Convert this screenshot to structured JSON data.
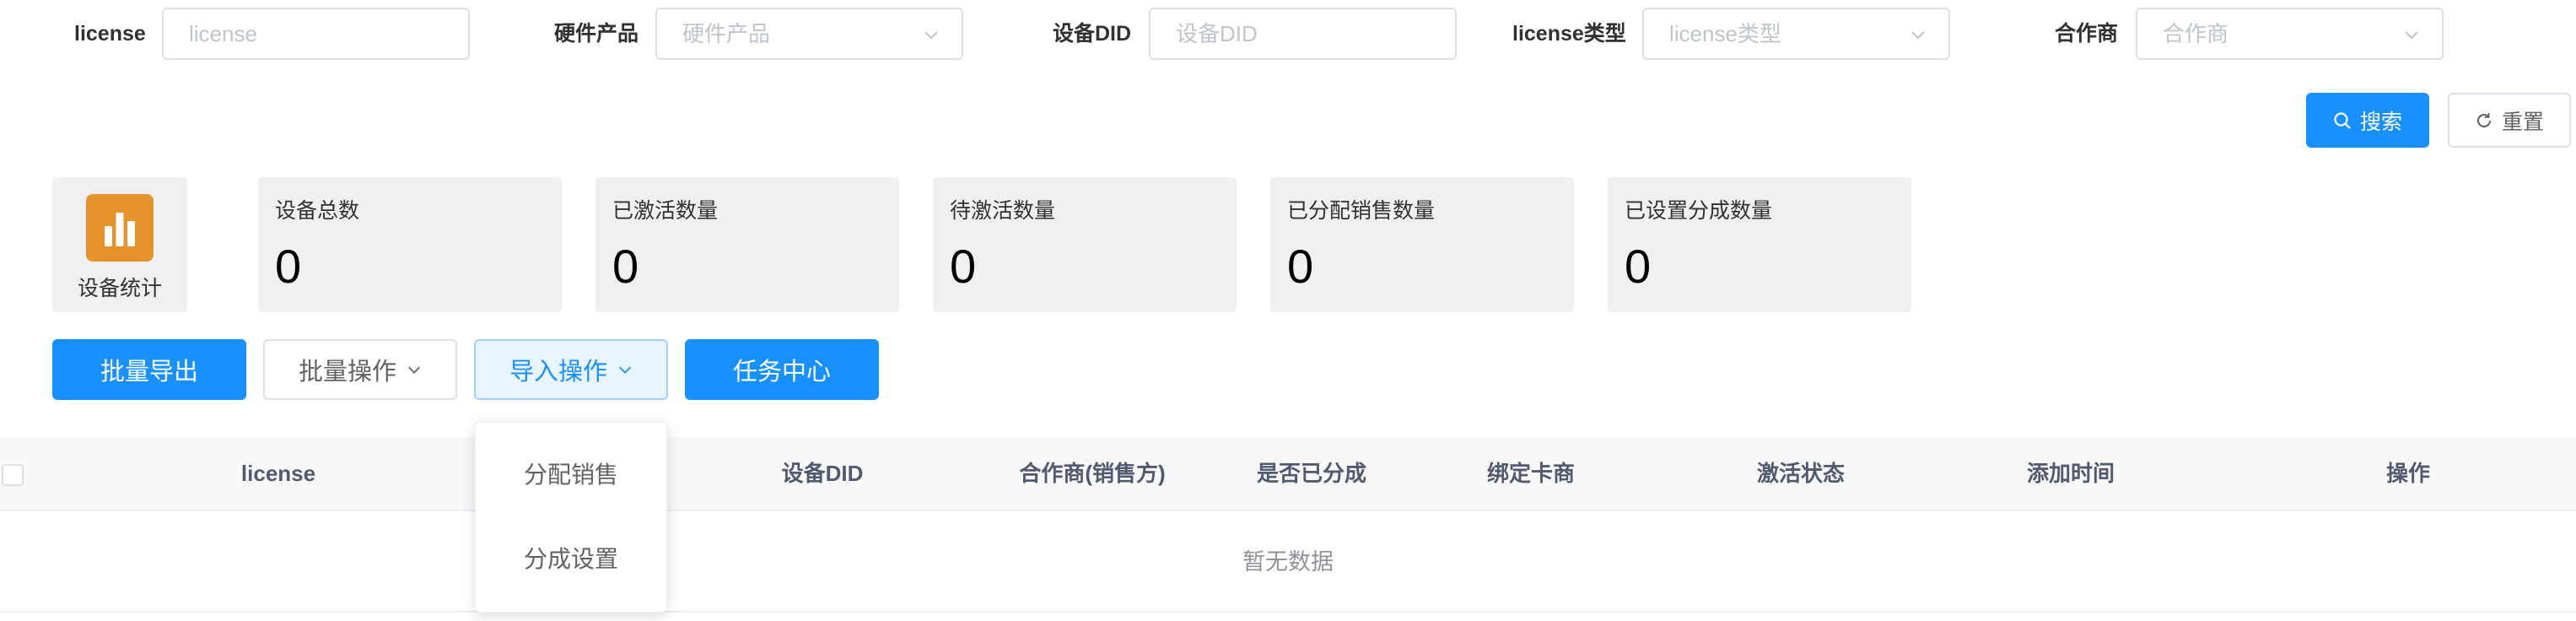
{
  "filters": {
    "license": {
      "label": "license",
      "placeholder": "license"
    },
    "hardware_product": {
      "label": "硬件产品",
      "placeholder": "硬件产品"
    },
    "device_did": {
      "label": "设备DID",
      "placeholder": "设备DID"
    },
    "license_type": {
      "label": "license类型",
      "placeholder": "license类型"
    },
    "partner": {
      "label": "合作商",
      "placeholder": "合作商"
    }
  },
  "buttons": {
    "search": "搜索",
    "reset": "重置",
    "batch_export": "批量导出",
    "batch_operation": "批量操作",
    "import_operation": "导入操作",
    "task_center": "任务中心"
  },
  "stats": {
    "icon_label": "设备统计",
    "icon_name": "bar-chart-icon",
    "cards": [
      {
        "title": "设备总数",
        "value": "0"
      },
      {
        "title": "已激活数量",
        "value": "0"
      },
      {
        "title": "待激活数量",
        "value": "0"
      },
      {
        "title": "已分配销售数量",
        "value": "0"
      },
      {
        "title": "已设置分成数量",
        "value": "0"
      }
    ]
  },
  "dropdown": {
    "items": [
      "分配销售",
      "分成设置"
    ]
  },
  "table": {
    "columns": [
      "license",
      "设备DID",
      "合作商(销售方)",
      "是否已分成",
      "绑定卡商",
      "激活状态",
      "添加时间",
      "操作"
    ],
    "empty_text": "暂无数据"
  },
  "colors": {
    "primary": "#1890ff",
    "stat_icon": "#e6932b"
  }
}
